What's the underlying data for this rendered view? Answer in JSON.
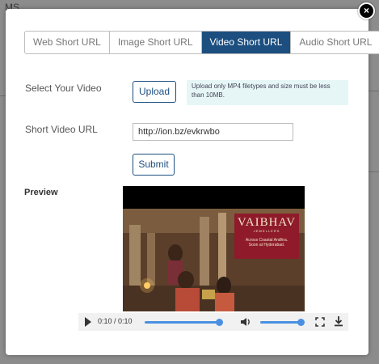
{
  "background": {
    "fragment_top_left": "MS"
  },
  "modal": {
    "close_label": "×",
    "tabs": [
      {
        "label": "Web Short URL",
        "active": false
      },
      {
        "label": "Image Short URL",
        "active": false
      },
      {
        "label": "Video Short URL",
        "active": true
      },
      {
        "label": "Audio Short URL",
        "active": false
      }
    ],
    "select_video_label": "Select Your Video",
    "upload_button": "Upload",
    "upload_hint": "Upload only MP4 filetypes and size must be less than 10MB.",
    "short_url_label": "Short Video URL",
    "short_url_value": "http://ion.bz/evkrwbo",
    "submit_button": "Submit",
    "preview_label": "Preview"
  },
  "video": {
    "ad_brand": "VAIBHAV",
    "ad_sub": "JEWELLERS",
    "ad_tagline_1": "Across Coastal Andhra.",
    "ad_tagline_2": "Soon at Hyderabad.",
    "time_display": "0:10 / 0:10",
    "progress_fraction": 1.0,
    "volume_fraction": 1.0
  },
  "colors": {
    "accent": "#1c4f80",
    "hint_bg": "#e6f6f7",
    "player_blue": "#4a90e2"
  }
}
